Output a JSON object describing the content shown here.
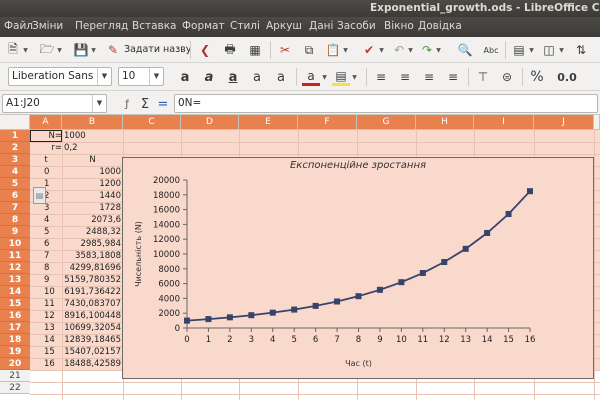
{
  "window": {
    "title": "Exponential_growth.ods - LibreOffice Calc"
  },
  "menu": [
    "Файл",
    "Зміни",
    "Перегляд",
    "Вставка",
    "Формат",
    "Стилі",
    "Аркуш",
    "Дані",
    "Засоби",
    "Вікно",
    "Довідка"
  ],
  "toolbar": {
    "name_range_label": "Задати назву"
  },
  "format": {
    "font_name": "Liberation Sans",
    "font_size": "10",
    "percent_label": "%",
    "number_label": "0.0"
  },
  "formula_bar": {
    "name_box": "A1:J20",
    "formula": "0N="
  },
  "columns": [
    "A",
    "B",
    "C",
    "D",
    "E",
    "F",
    "G",
    "H",
    "I",
    "J"
  ],
  "rows": [
    "1",
    "2",
    "3",
    "4",
    "5",
    "6",
    "7",
    "8",
    "9",
    "10",
    "11",
    "12",
    "13",
    "14",
    "15",
    "16",
    "17",
    "18",
    "19",
    "20",
    "21",
    "22"
  ],
  "cells": {
    "a1": "N=",
    "b1": "1000",
    "a2": "r=",
    "b2": "0,2",
    "a3": "t",
    "b3": "N",
    "t_values": [
      "0",
      "1",
      "2",
      "3",
      "4",
      "5",
      "6",
      "7",
      "8",
      "9",
      "10",
      "11",
      "12",
      "13",
      "14",
      "15",
      "16"
    ],
    "n_values": [
      "1000",
      "1200",
      "1440",
      "1728",
      "2073,6",
      "2488,32",
      "2985,984",
      "3583,1808",
      "4299,81696",
      "5159,780352",
      "6191,736422",
      "7430,083707",
      "8916,100448",
      "10699,32054",
      "12839,18465",
      "15407,02157",
      "18488,42589"
    ]
  },
  "chart_data": {
    "type": "line",
    "title": "Експоненційне зростання",
    "xlabel": "Час (t)",
    "ylabel": "Чисельність (N)",
    "x": [
      0,
      1,
      2,
      3,
      4,
      5,
      6,
      7,
      8,
      9,
      10,
      11,
      12,
      13,
      14,
      15,
      16
    ],
    "series": [
      {
        "name": "",
        "values": [
          1000,
          1200,
          1440,
          1728,
          2073.6,
          2488.32,
          2985.984,
          3583.1808,
          4299.81696,
          5159.780352,
          6191.736422,
          7430.083707,
          8916.100448,
          10699.32054,
          12839.18465,
          15407.02157,
          18488.42589
        ]
      }
    ],
    "xlim": [
      0,
      16
    ],
    "ylim": [
      0,
      20000
    ],
    "yticks": [
      0,
      2000,
      4000,
      6000,
      8000,
      10000,
      12000,
      14000,
      16000,
      18000,
      20000
    ],
    "xticks": [
      0,
      1,
      2,
      3,
      4,
      5,
      6,
      7,
      8,
      9,
      10,
      11,
      12,
      13,
      14,
      15,
      16
    ],
    "grid": false,
    "legend": "none",
    "line_color": "#36436b"
  }
}
